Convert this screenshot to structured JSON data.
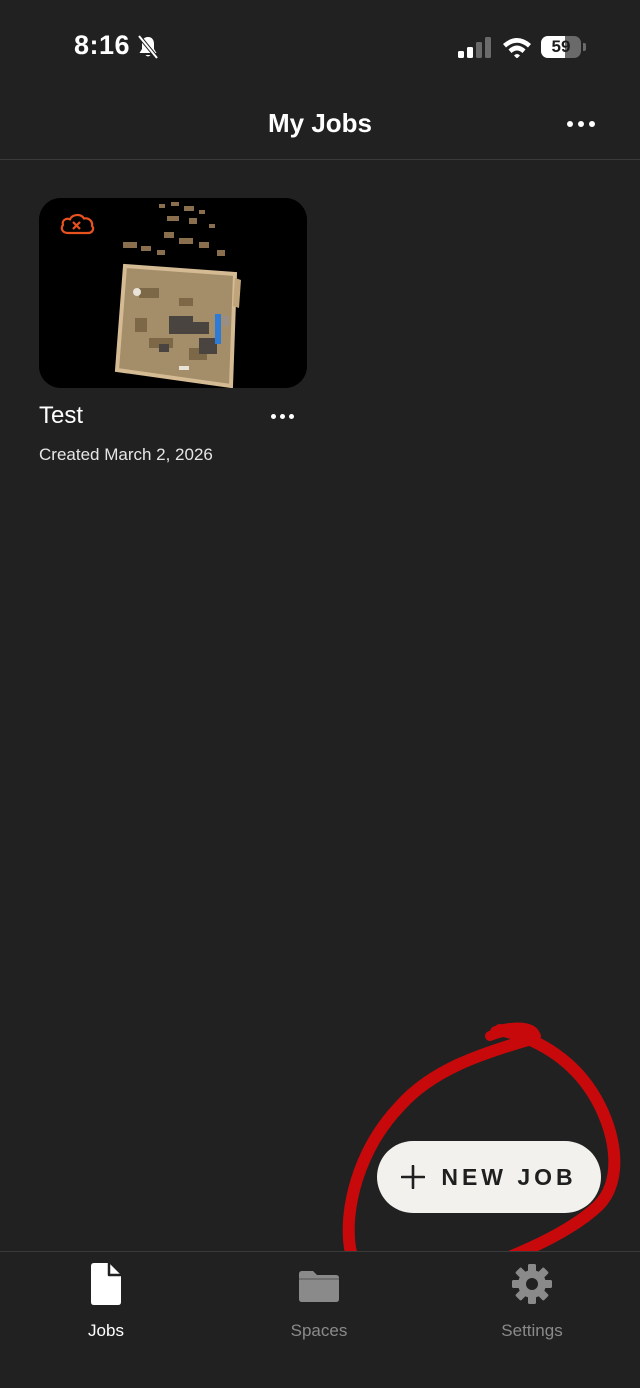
{
  "status_bar": {
    "time": "8:16",
    "battery_level": "59",
    "battery_fraction": 0.59,
    "cellular_bars_active": 2,
    "cellular_bars_total": 4,
    "silent_mode_icon": "bell-slash-icon"
  },
  "header": {
    "title": "My Jobs",
    "more_icon": "more-horizontal-icon"
  },
  "jobs": [
    {
      "name": "Test",
      "created": "Created March 2, 2026",
      "sync_status_icon": "cloud-error-icon",
      "sync_status_color": "#e8521f"
    }
  ],
  "fab": {
    "label": "NEW JOB",
    "icon": "plus-icon"
  },
  "tabs": [
    {
      "label": "Jobs",
      "icon": "document-icon",
      "active": true
    },
    {
      "label": "Spaces",
      "icon": "folder-icon",
      "active": false
    },
    {
      "label": "Settings",
      "icon": "gear-icon",
      "active": false
    }
  ],
  "colors": {
    "background": "#212121",
    "fab_background": "#f2f1ed",
    "annotation_red": "#c8090b",
    "inactive_tab": "#8a8a8a"
  }
}
